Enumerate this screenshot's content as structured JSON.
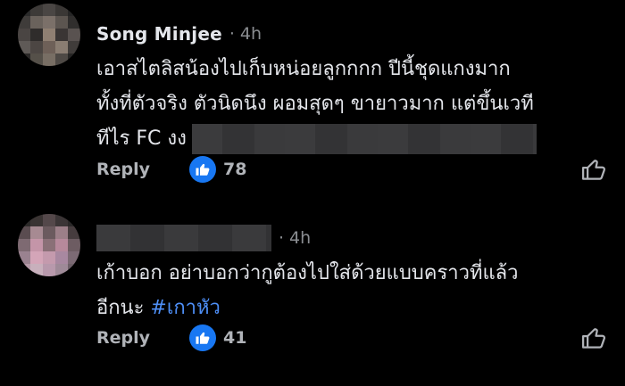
{
  "colors": {
    "background": "#000000",
    "name_text": "#e4e6eb",
    "meta_text": "#8a8d91",
    "hashtag": "#4e8ff7",
    "like_badge": "#1877f2"
  },
  "comments": [
    {
      "author": "Song Minjee",
      "separator": "·",
      "time": "4h",
      "lines": [
        "เอาสไตลิสน้องไปเก็บหน่อยลูกกกก ปีนี้ชุดแกงมาก",
        "ทั้งที่ตัวจริง ตัวนิดนึง ผอมสุดๆ ขายาวมาก แต่ขึ้นเวที",
        "ทีไร FC งง"
      ],
      "reply_label": "Reply",
      "like_icon": "thumbs-up-icon",
      "like_count": "78"
    },
    {
      "author": "",
      "separator": "·",
      "time": "4h",
      "lines": [
        "เก้าบอก อย่าบอกว่ากูต้องไปใส่ด้วยแบบคราวที่แล้ว",
        "อีกนะ"
      ],
      "hashtag": "#เกาหัว",
      "reply_label": "Reply",
      "like_icon": "thumbs-up-icon",
      "like_count": "41"
    }
  ]
}
